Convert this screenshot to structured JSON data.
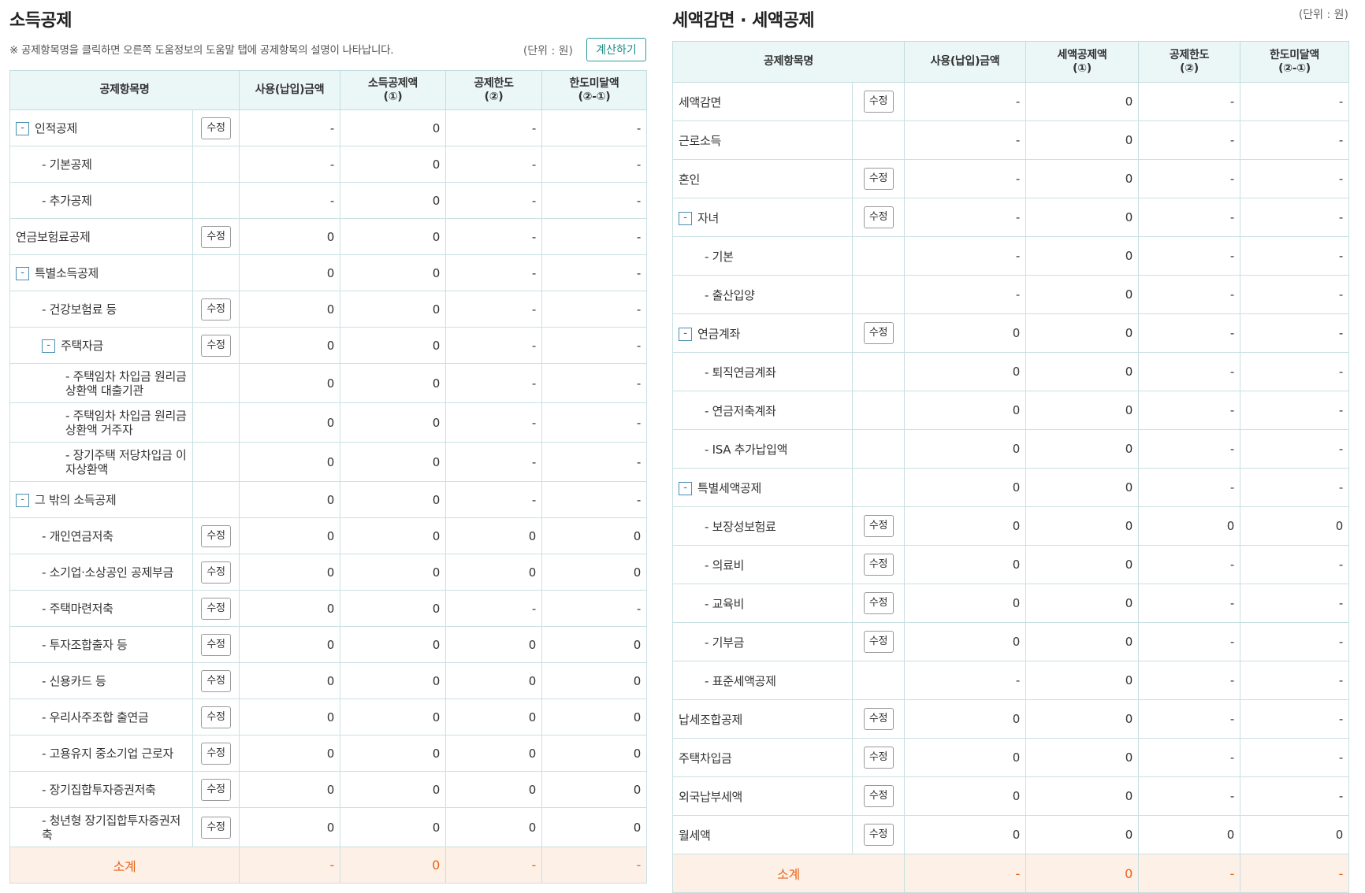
{
  "left": {
    "title": "소득공제",
    "note": "※ 공제항목명을 클릭하면 오른쪽 도움정보의 도움말 탭에 공제항목의 설명이 나타납니다.",
    "unit": "(단위 : 원)",
    "calc_label": "계산하기",
    "headers": {
      "name": "공제항목명",
      "amount": "사용(납입)금액",
      "deduct1": "소득공제액",
      "deduct2": "(①)",
      "limit1": "공제한도",
      "limit2": "(②)",
      "under1": "한도미달액",
      "under2": "(②-①)"
    },
    "rows": [
      {
        "name": "인적공제",
        "toggle": "-",
        "edit": "수정",
        "amount": "-",
        "deduct": "0",
        "limit": "-",
        "under": "-"
      },
      {
        "name": "- 기본공제",
        "amount": "-",
        "deduct": "0",
        "limit": "-",
        "under": "-"
      },
      {
        "name": "- 추가공제",
        "amount": "-",
        "deduct": "0",
        "limit": "-",
        "under": "-"
      },
      {
        "name": "연금보험료공제",
        "edit": "수정",
        "amount": "0",
        "deduct": "0",
        "limit": "-",
        "under": "-"
      },
      {
        "name": "특별소득공제",
        "toggle": "-",
        "amount": "0",
        "deduct": "0",
        "limit": "-",
        "under": "-"
      },
      {
        "name": "- 건강보험료 등",
        "edit": "수정",
        "amount": "0",
        "deduct": "0",
        "limit": "-",
        "under": "-"
      },
      {
        "name": "주택자금",
        "toggle": "-",
        "edit": "수정",
        "amount": "0",
        "deduct": "0",
        "limit": "-",
        "under": "-"
      },
      {
        "name": "- 주택임차 차입금 원리금상환액 대출기관",
        "amount": "0",
        "deduct": "0",
        "limit": "-",
        "under": "-"
      },
      {
        "name": "- 주택임차 차입금 원리금상환액 거주자",
        "amount": "0",
        "deduct": "0",
        "limit": "-",
        "under": "-"
      },
      {
        "name": "- 장기주택 저당차입금 이자상환액",
        "amount": "0",
        "deduct": "0",
        "limit": "-",
        "under": "-"
      },
      {
        "name": "그 밖의 소득공제",
        "toggle": "-",
        "amount": "0",
        "deduct": "0",
        "limit": "-",
        "under": "-"
      },
      {
        "name": "- 개인연금저축",
        "edit": "수정",
        "amount": "0",
        "deduct": "0",
        "limit": "0",
        "under": "0"
      },
      {
        "name": "- 소기업·소상공인 공제부금",
        "edit": "수정",
        "amount": "0",
        "deduct": "0",
        "limit": "0",
        "under": "0"
      },
      {
        "name": "- 주택마련저축",
        "edit": "수정",
        "amount": "0",
        "deduct": "0",
        "limit": "-",
        "under": "-"
      },
      {
        "name": "- 투자조합출자 등",
        "edit": "수정",
        "amount": "0",
        "deduct": "0",
        "limit": "0",
        "under": "0"
      },
      {
        "name": "- 신용카드 등",
        "edit": "수정",
        "amount": "0",
        "deduct": "0",
        "limit": "0",
        "under": "0"
      },
      {
        "name": "- 우리사주조합 출연금",
        "edit": "수정",
        "amount": "0",
        "deduct": "0",
        "limit": "0",
        "under": "0"
      },
      {
        "name": "- 고용유지 중소기업 근로자",
        "edit": "수정",
        "amount": "0",
        "deduct": "0",
        "limit": "0",
        "under": "0"
      },
      {
        "name": "- 장기집합투자증권저축",
        "edit": "수정",
        "amount": "0",
        "deduct": "0",
        "limit": "0",
        "under": "0"
      },
      {
        "name": "- 청년형 장기집합투자증권저축",
        "edit": "수정",
        "amount": "0",
        "deduct": "0",
        "limit": "0",
        "under": "0"
      }
    ],
    "total": {
      "label": "소계",
      "amount": "-",
      "deduct": "0",
      "limit": "-",
      "under": "-"
    }
  },
  "right": {
    "title": "세액감면 · 세액공제",
    "unit": "(단위 : 원)",
    "headers": {
      "name": "공제항목명",
      "amount": "사용(납입)금액",
      "deduct1": "세액공제액",
      "deduct2": "(①)",
      "limit1": "공제한도",
      "limit2": "(②)",
      "under1": "한도미달액",
      "under2": "(②-①)"
    },
    "rows": [
      {
        "name": "세액감면",
        "edit": "수정",
        "amount": "-",
        "deduct": "0",
        "limit": "-",
        "under": "-"
      },
      {
        "name": "근로소득",
        "amount": "-",
        "deduct": "0",
        "limit": "-",
        "under": "-"
      },
      {
        "name": "혼인",
        "edit": "수정",
        "amount": "-",
        "deduct": "0",
        "limit": "-",
        "under": "-"
      },
      {
        "name": "자녀",
        "toggle": "-",
        "edit": "수정",
        "amount": "-",
        "deduct": "0",
        "limit": "-",
        "under": "-"
      },
      {
        "name": "- 기본",
        "amount": "-",
        "deduct": "0",
        "limit": "-",
        "under": "-"
      },
      {
        "name": "- 출산입양",
        "amount": "-",
        "deduct": "0",
        "limit": "-",
        "under": "-"
      },
      {
        "name": "연금계좌",
        "toggle": "-",
        "edit": "수정",
        "amount": "0",
        "deduct": "0",
        "limit": "-",
        "under": "-"
      },
      {
        "name": "- 퇴직연금계좌",
        "amount": "0",
        "deduct": "0",
        "limit": "-",
        "under": "-"
      },
      {
        "name": "- 연금저축계좌",
        "amount": "0",
        "deduct": "0",
        "limit": "-",
        "under": "-"
      },
      {
        "name": "- ISA 추가납입액",
        "amount": "0",
        "deduct": "0",
        "limit": "-",
        "under": "-"
      },
      {
        "name": "특별세액공제",
        "toggle": "-",
        "amount": "0",
        "deduct": "0",
        "limit": "-",
        "under": "-"
      },
      {
        "name": "- 보장성보험료",
        "edit": "수정",
        "amount": "0",
        "deduct": "0",
        "limit": "0",
        "under": "0"
      },
      {
        "name": "- 의료비",
        "edit": "수정",
        "amount": "0",
        "deduct": "0",
        "limit": "-",
        "under": "-"
      },
      {
        "name": "- 교육비",
        "edit": "수정",
        "amount": "0",
        "deduct": "0",
        "limit": "-",
        "under": "-"
      },
      {
        "name": "- 기부금",
        "edit": "수정",
        "amount": "0",
        "deduct": "0",
        "limit": "-",
        "under": "-"
      },
      {
        "name": "- 표준세액공제",
        "amount": "-",
        "deduct": "0",
        "limit": "-",
        "under": "-"
      },
      {
        "name": "납세조합공제",
        "edit": "수정",
        "amount": "0",
        "deduct": "0",
        "limit": "-",
        "under": "-"
      },
      {
        "name": "주택차입금",
        "edit": "수정",
        "amount": "0",
        "deduct": "0",
        "limit": "-",
        "under": "-"
      },
      {
        "name": "외국납부세액",
        "edit": "수정",
        "amount": "0",
        "deduct": "0",
        "limit": "-",
        "under": "-"
      },
      {
        "name": "월세액",
        "edit": "수정",
        "amount": "0",
        "deduct": "0",
        "limit": "0",
        "under": "0"
      }
    ],
    "total": {
      "label": "소계",
      "amount": "-",
      "deduct": "0",
      "limit": "-",
      "under": "-"
    }
  }
}
